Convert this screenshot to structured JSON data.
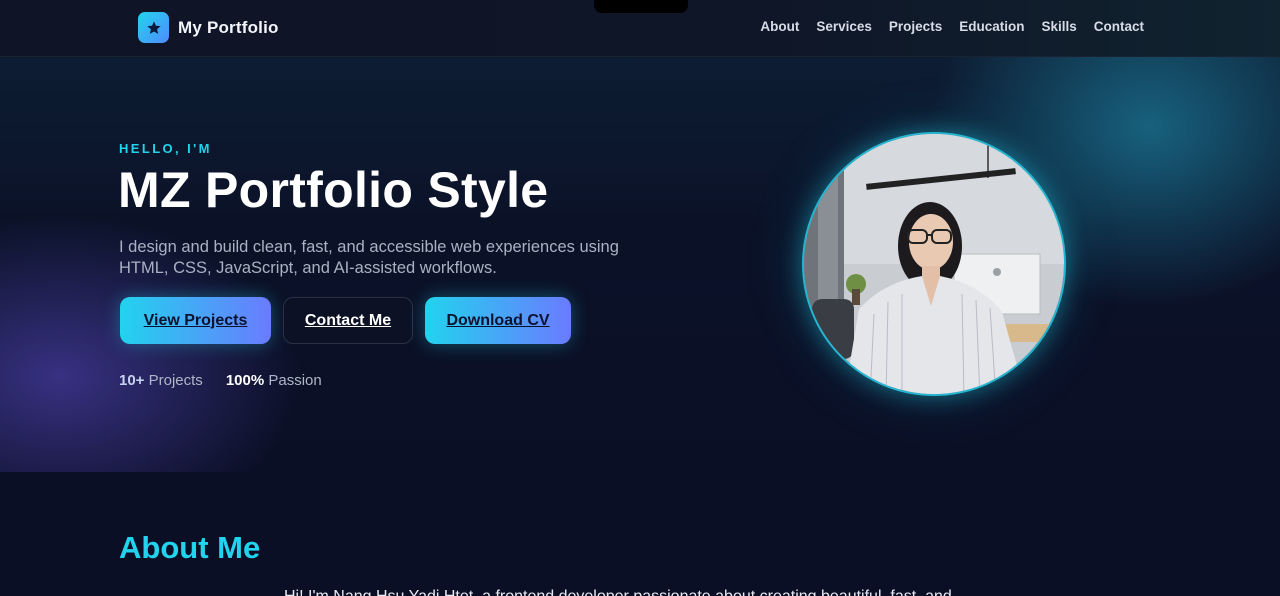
{
  "brand": {
    "name": "My Portfolio",
    "icon": "star-icon"
  },
  "nav": {
    "items": [
      "About",
      "Services",
      "Projects",
      "Education",
      "Skills",
      "Contact"
    ]
  },
  "hero": {
    "greeting": "HELLO, I'M",
    "title": "MZ Portfolio Style",
    "lede": "I design and build clean, fast, and accessible web experiences using HTML, CSS, JavaScript, and AI-assisted workflows.",
    "buttons": {
      "view_projects": "View Projects",
      "contact_me": "Contact Me",
      "download_cv": "Download CV"
    },
    "stats": [
      {
        "value": "10+",
        "label": "Projects"
      },
      {
        "value": "100%",
        "label": "Passion"
      }
    ]
  },
  "about": {
    "title": "About Me",
    "text": "Hi! I'm Nang Hsu Yadi Htet, a frontend developer passionate about creating beautiful, fast, and"
  },
  "colors": {
    "accent": "#22d3ee",
    "accent_2": "#6a7bff",
    "background": "#0b0f26"
  }
}
